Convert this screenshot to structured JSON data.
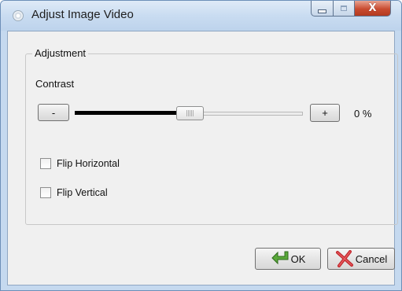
{
  "window": {
    "title": "Adjust Image Video",
    "minimize_icon": "minimize-icon",
    "maximize_icon": "maximize-icon",
    "close_glyph": "X"
  },
  "adjustment": {
    "group_label": "Adjustment",
    "contrast_label": "Contrast",
    "decrease_label": "-",
    "increase_label": "+",
    "contrast_value": "0 %",
    "contrast_slider_level": 0.49,
    "flip_horizontal_label": "Flip Horizontal",
    "flip_horizontal_checked": false,
    "flip_vertical_label": "Flip Vertical",
    "flip_vertical_checked": false
  },
  "buttons": {
    "ok_label": "OK",
    "ok_icon": "green-arrow-icon",
    "cancel_label": "Cancel",
    "cancel_icon": "red-x-icon"
  },
  "colors": {
    "title_bar": "#c9dcf1",
    "close_button": "#c94b30",
    "dialog_background": "#f0f0f0"
  }
}
